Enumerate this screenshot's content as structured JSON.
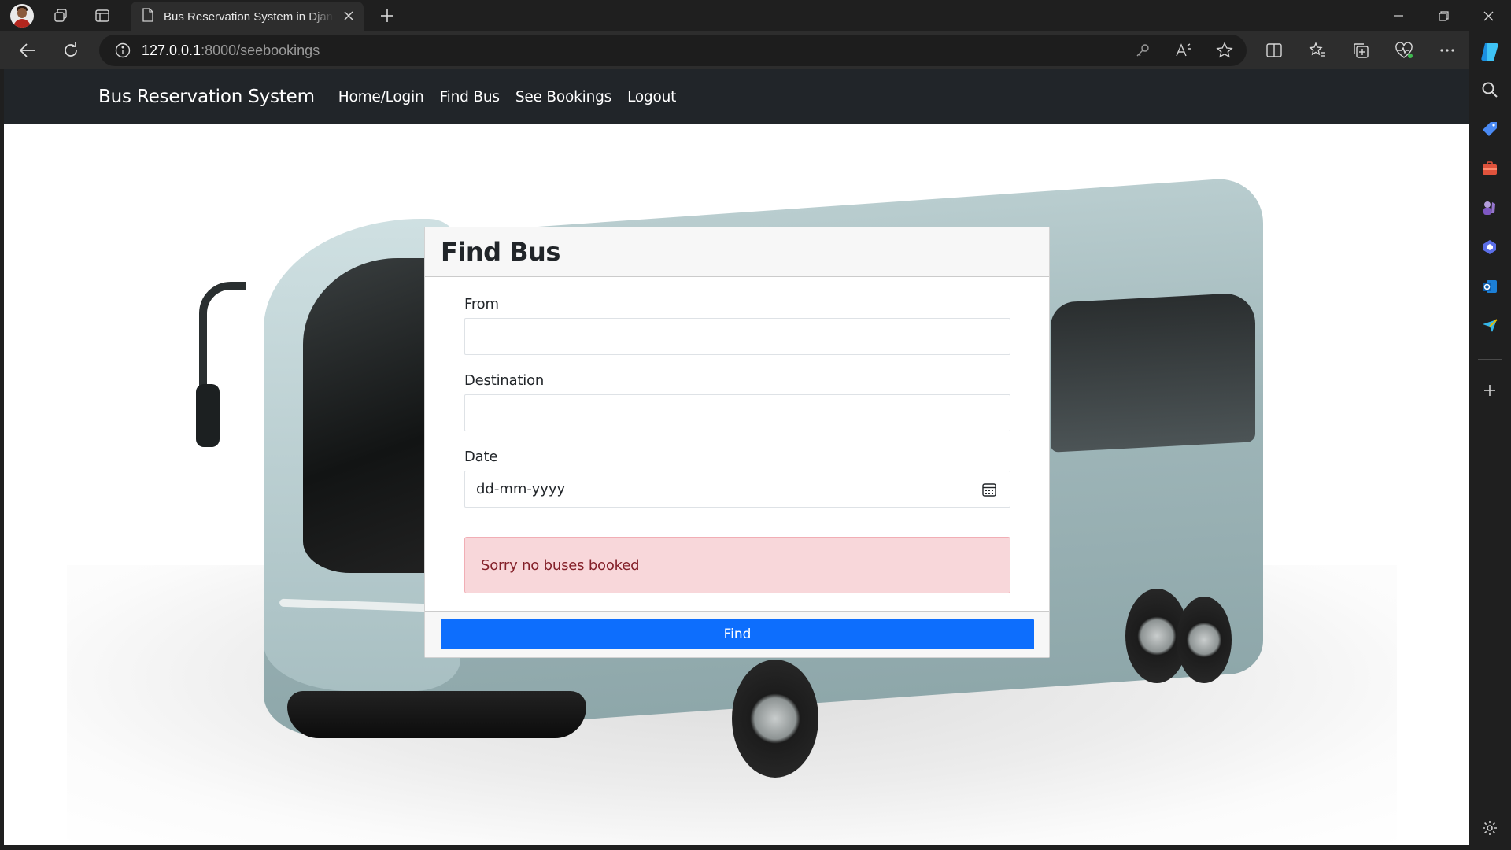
{
  "browser": {
    "tab_title": "Bus Reservation System in Django",
    "url_host": "127.0.0.1",
    "url_rest": ":8000/seebookings"
  },
  "site": {
    "brand": "Bus Reservation System",
    "nav": [
      {
        "label": "Home/Login"
      },
      {
        "label": "Find Bus"
      },
      {
        "label": "See Bookings"
      },
      {
        "label": "Logout"
      }
    ]
  },
  "form": {
    "title": "Find Bus",
    "from_label": "From",
    "from_value": "",
    "destination_label": "Destination",
    "destination_value": "",
    "date_label": "Date",
    "date_placeholder": "dd-mm-yyyy",
    "alert_text": "Sorry no buses booked",
    "submit_label": "Find"
  },
  "colors": {
    "primary": "#0d6efd",
    "navbar": "#212529",
    "alert_bg": "#f8d7da",
    "alert_text": "#842029"
  }
}
